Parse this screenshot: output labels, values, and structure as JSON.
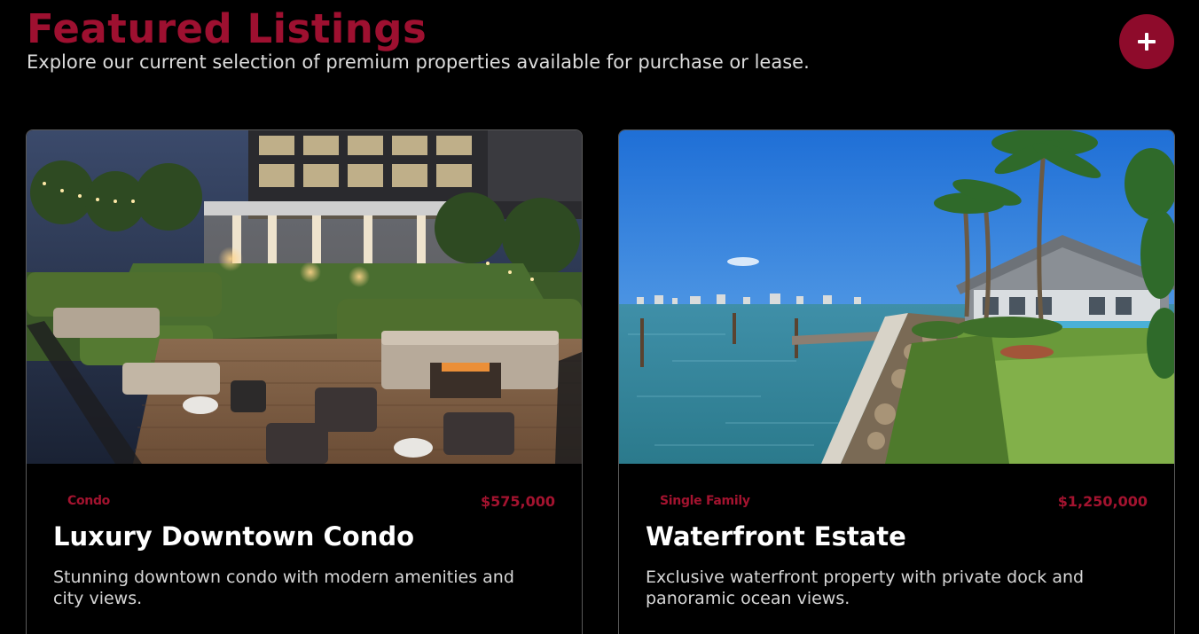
{
  "header": {
    "title": "Featured Listings",
    "subtitle": "Explore our current selection of premium properties available for purchase or lease."
  },
  "add_button": {
    "icon": "plus-icon",
    "color": "#8e0b2b"
  },
  "accent_color": "#a3132f",
  "listings": [
    {
      "type": "Condo",
      "price": "$575,000",
      "title": "Luxury Downtown Condo",
      "description": "Stunning downtown condo with modern amenities and city views.",
      "image": "rooftop-terrace-night-photo"
    },
    {
      "type": "Single Family",
      "price": "$1,250,000",
      "title": "Waterfront Estate",
      "description": "Exclusive waterfront property with private dock and panoramic ocean views.",
      "image": "waterfront-house-palm-trees-photo"
    }
  ]
}
